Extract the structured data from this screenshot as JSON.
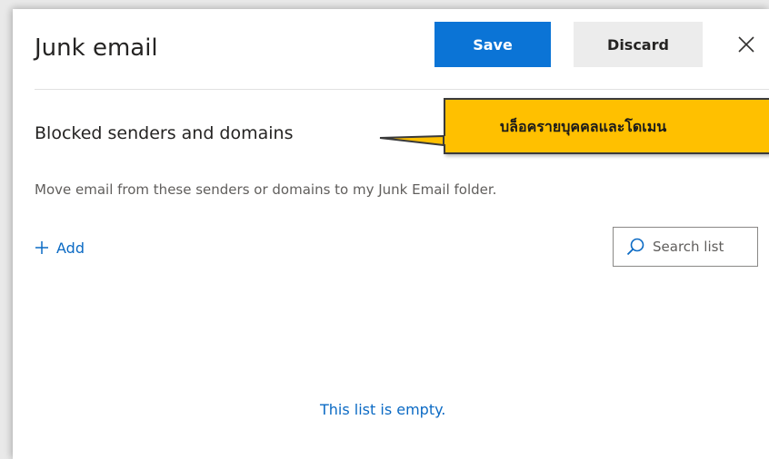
{
  "header": {
    "title": "Junk email",
    "save_label": "Save",
    "discard_label": "Discard",
    "close_icon": "close-icon"
  },
  "section": {
    "heading": "Blocked senders and domains",
    "description": "Move email from these senders or domains to my Junk Email folder.",
    "add_label": "Add",
    "add_icon": "plus-icon"
  },
  "search": {
    "placeholder": "Search list",
    "icon": "search-icon"
  },
  "list": {
    "empty_message": "This list is empty."
  },
  "annotation": {
    "callout_text": "บล็อครายบุคคลและโดเมน",
    "callout_color": "#ffc000"
  },
  "colors": {
    "accent": "#0b74d6",
    "link": "#0b6ac4"
  }
}
